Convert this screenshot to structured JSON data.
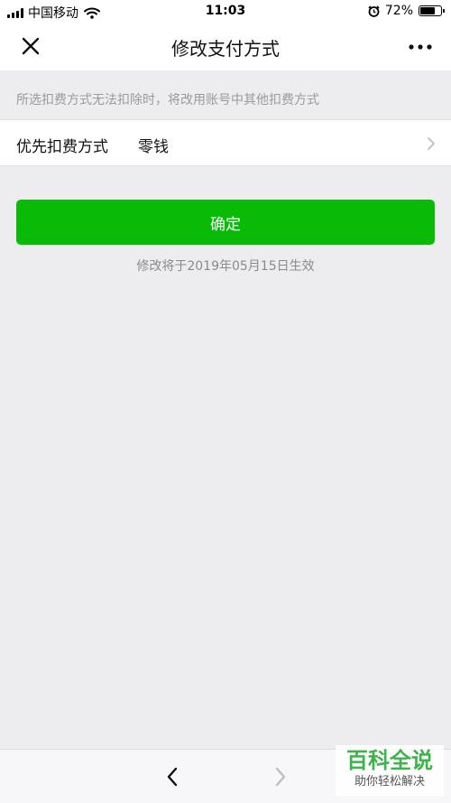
{
  "status_bar": {
    "carrier": "中国移动",
    "time": "11:03",
    "battery_percent": "72%",
    "battery_level": 0.72,
    "icons": [
      "signal-icon",
      "wifi-icon",
      "alarm-icon",
      "battery-icon"
    ]
  },
  "nav": {
    "title": "修改支付方式",
    "close_icon": "close-icon",
    "more_icon": "more-icon"
  },
  "hint": "所选扣费方式无法扣除时，将改用账号中其他扣费方式",
  "payment_row": {
    "label": "优先扣费方式",
    "value": "零钱",
    "chevron_icon": "chevron-right-icon"
  },
  "confirm_button": {
    "label": "确定",
    "color": "#09bb07"
  },
  "effective_note": "修改将于2019年05月15日生效",
  "toolbar": {
    "back_icon": "chevron-left-icon",
    "forward_icon": "chevron-right-icon"
  },
  "watermark": {
    "title": "百科全说",
    "subtitle": "助你轻松解决"
  }
}
